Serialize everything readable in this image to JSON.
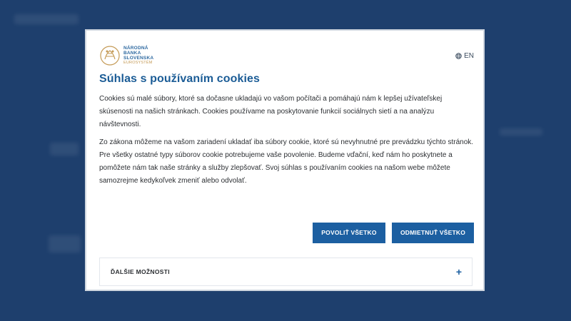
{
  "logo": {
    "line1": "NÁRODNÁ",
    "line2": "BANKA",
    "line3": "SLOVENSKA",
    "line4": "EUROSYSTÉM"
  },
  "language": {
    "label": "EN",
    "icon": "globe-icon"
  },
  "dialog": {
    "title": "Súhlas s používaním cookies",
    "paragraph1": "Cookies sú malé súbory, ktoré sa dočasne ukladajú vo vašom počítači a pomáhajú nám k lepšej užívateľskej skúsenosti na našich stránkach. Cookies používame na poskytovanie funkcií sociálnych sietí a na analýzu návštevnosti.",
    "paragraph2": "Zo zákona môžeme na vašom zariadení ukladať iba súbory cookie, ktoré sú nevyhnutné pre prevádzku týchto stránok. Pre všetky ostatné typy súborov cookie potrebujeme vaše povolenie. Budeme vďační, keď nám ho poskytnete a pomôžete nám tak naše stránky a služby zlepšovať. Svoj súhlas s používaním cookies na našom webe môžete samozrejme kedykoľvek zmeniť alebo odvolať.",
    "allow_all_label": "POVOLIŤ VŠETKO",
    "reject_all_label": "ODMIETNUŤ VŠETKO",
    "more_options_label": "ĎALŠIE MOŽNOSTI",
    "expand_symbol": "+"
  },
  "colors": {
    "primary": "#1c5fa1",
    "title": "#1b5c96",
    "backdrop": "#1e3f6d",
    "logo_gold": "#c49a55"
  }
}
